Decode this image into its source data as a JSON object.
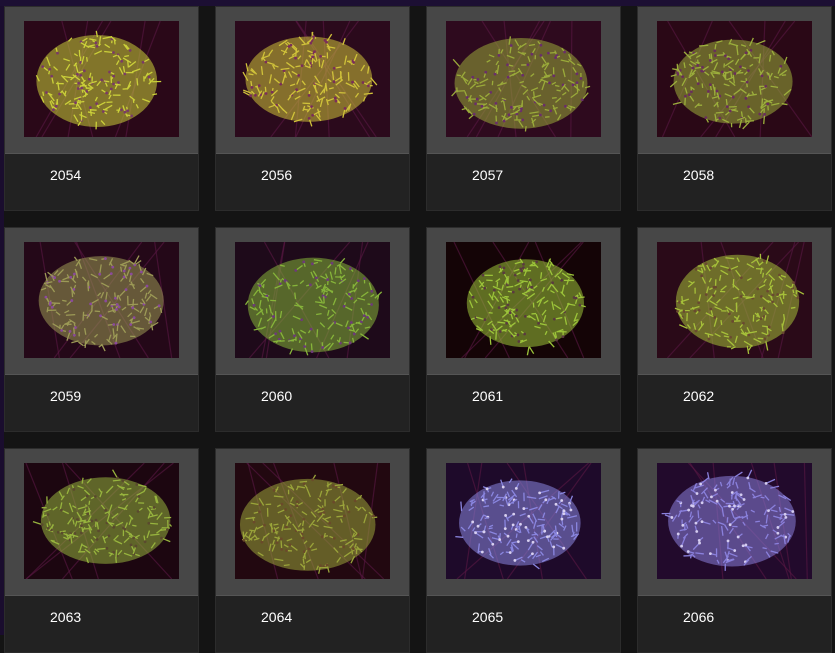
{
  "gallery": {
    "items": [
      {
        "label": "2054",
        "coral": "#cbd03a",
        "tip": "#7a3a66",
        "bg": "#2a0818"
      },
      {
        "label": "2056",
        "coral": "#d0c23a",
        "tip": "#7b2e5a",
        "bg": "#2b0a1c"
      },
      {
        "label": "2057",
        "coral": "#9aaa3a",
        "tip": "#6a2e6a",
        "bg": "#2e0a1e"
      },
      {
        "label": "2058",
        "coral": "#9caf3c",
        "tip": "#6a2e5c",
        "bg": "#2a0816"
      },
      {
        "label": "2059",
        "coral": "#9c9a56",
        "tip": "#8a4a9a",
        "bg": "#240818"
      },
      {
        "label": "2060",
        "coral": "#86b43a",
        "tip": "#6e3a7a",
        "bg": "#1e0a1a"
      },
      {
        "label": "2061",
        "coral": "#9cc43a",
        "tip": "#5a3a40",
        "bg": "#140406"
      },
      {
        "label": "2062",
        "coral": "#a6c03a",
        "tip": "#6a4a30",
        "bg": "#2a0a18"
      },
      {
        "label": "2063",
        "coral": "#97b43e",
        "tip": "#5a4a2e",
        "bg": "#1c0610"
      },
      {
        "label": "2064",
        "coral": "#9aa43a",
        "tip": "#6a4a2a",
        "bg": "#220810"
      },
      {
        "label": "2065",
        "coral": "#8a86e0",
        "tip": "#d8d0f0",
        "bg": "#1e0a2a"
      },
      {
        "label": "2066",
        "coral": "#8a80dc",
        "tip": "#d4ccf0",
        "bg": "#220a2c"
      }
    ]
  }
}
